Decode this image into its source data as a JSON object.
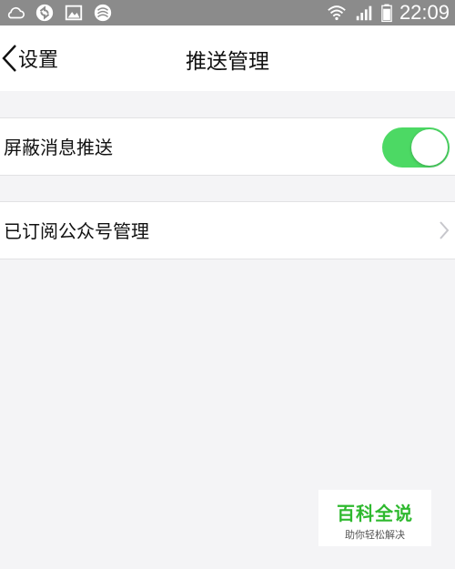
{
  "status_bar": {
    "time": "22:09",
    "icons": [
      "cloud-icon",
      "sync-icon",
      "image-icon",
      "carrier-icon",
      "wifi-icon",
      "signal-icon",
      "battery-icon"
    ]
  },
  "nav": {
    "back_label": "设置",
    "title": "推送管理"
  },
  "settings": {
    "mute_push": {
      "label": "屏蔽消息推送",
      "enabled": true
    },
    "subscriptions": {
      "label": "已订阅公众号管理"
    }
  },
  "watermark": {
    "title": "百科全说",
    "subtitle": "助你轻松解决"
  },
  "colors": {
    "toggle_on": "#4cd964",
    "background": "#f4f4f6",
    "status_bar": "#8b8b8b",
    "watermark_green": "#2fb92f"
  }
}
